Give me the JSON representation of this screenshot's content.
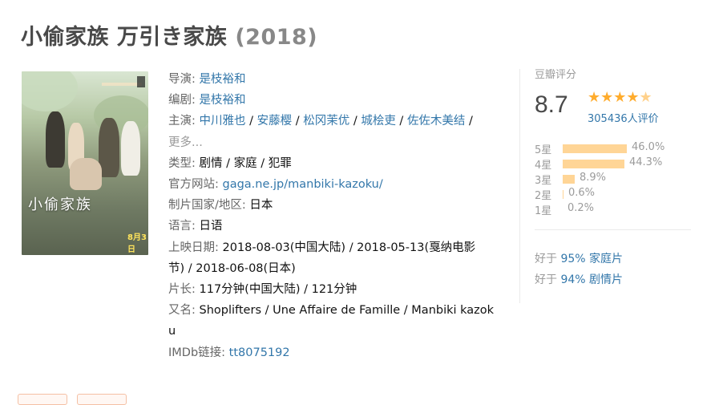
{
  "title": {
    "main": "小偷家族 万引き家族",
    "year": "(2018)"
  },
  "poster": {
    "title_text": "小偷家族",
    "date_text": "8月3日"
  },
  "info": {
    "director_label": "导演",
    "director": "是枝裕和",
    "writer_label": "编剧",
    "writer": "是枝裕和",
    "cast_label": "主演",
    "cast": [
      "中川雅也",
      "安藤樱",
      "松冈茉优",
      "城桧吏",
      "佐佐木美结"
    ],
    "cast_more": "更多...",
    "genre_label": "类型:",
    "genre": "剧情 / 家庭 / 犯罪",
    "website_label": "官方网站:",
    "website": "gaga.ne.jp/manbiki-kazoku/",
    "country_label": "制片国家/地区:",
    "country": "日本",
    "language_label": "语言:",
    "language": "日语",
    "release_label": "上映日期:",
    "release_line1": "2018-08-03(中国大陆) / 2018-05-13(戛纳电影",
    "release_line2": "节) / 2018-06-08(日本)",
    "runtime_label": "片长:",
    "runtime": "117分钟(中国大陆) / 121分钟",
    "aka_label": "又名:",
    "aka_line1": "Shoplifters / Une Affaire de Famille / Manbiki kazok",
    "aka_line2": "u",
    "imdb_label": "IMDb链接:",
    "imdb": "tt8075192"
  },
  "rating": {
    "label": "豆瓣评分",
    "score": "8.7",
    "stars_value": 4.5,
    "votes": "305436人评价",
    "distribution": [
      {
        "label": "5星",
        "percent": "46.0%",
        "value": 46.0
      },
      {
        "label": "4星",
        "percent": "44.3%",
        "value": 44.3
      },
      {
        "label": "3星",
        "percent": "8.9%",
        "value": 8.9
      },
      {
        "label": "2星",
        "percent": "0.6%",
        "value": 0.6
      },
      {
        "label": "1星",
        "percent": "0.2%",
        "value": 0.2
      }
    ],
    "better_than": [
      {
        "prefix": "好于",
        "link": "95% 家庭片"
      },
      {
        "prefix": "好于",
        "link": "94% 剧情片"
      }
    ]
  },
  "colors": {
    "link": "#3377aa",
    "star": "#ffac2d",
    "bar": "#ffd596",
    "label": "#666666"
  }
}
